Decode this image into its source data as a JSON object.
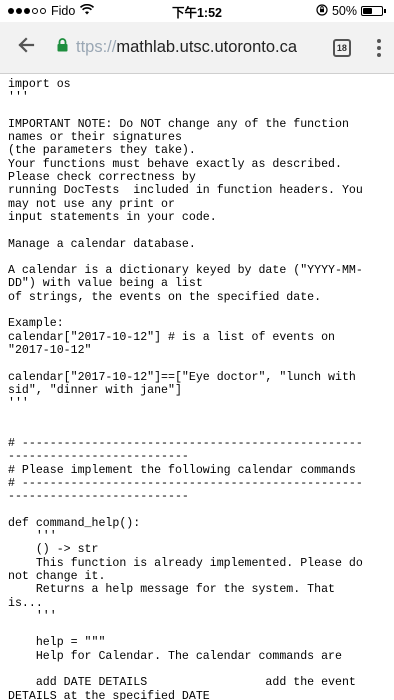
{
  "status_bar": {
    "carrier": "Fido",
    "time": "下午1:52",
    "battery_percent": "50%",
    "battery_level": 0.5,
    "signal_dots_filled": 3,
    "signal_dots_empty": 2
  },
  "toolbar": {
    "url_scheme": "ttps://",
    "url_host": "mathlab.utsc.utoronto.ca",
    "tab_count": "18"
  },
  "icons": {
    "back": "arrow-left-icon",
    "lock": "lock-icon",
    "wifi": "wifi-icon",
    "menu": "more-vert-icon"
  },
  "colors": {
    "lock": "#1e8e3e",
    "toolbar_bg": "#f2f2f2"
  },
  "code": {
    "lines": [
      "import os",
      "'''",
      "",
      "IMPORTANT NOTE: Do NOT change any of the function",
      "names or their signatures",
      "(the parameters they take).",
      "Your functions must behave exactly as described.",
      "Please check correctness by",
      "running DocTests  included in function headers. You",
      "may not use any print or",
      "input statements in your code.",
      "",
      "Manage a calendar database.",
      "",
      "A calendar is a dictionary keyed by date (\"YYYY-MM-",
      "DD\") with value being a list",
      "of strings, the events on the specified date.",
      "",
      "Example:",
      "calendar[\"2017-10-12\"] # is a list of events on",
      "\"2017-10-12\"",
      "",
      "calendar[\"2017-10-12\"]==[\"Eye doctor\", \"lunch with",
      "sid\", \"dinner with jane\"]",
      "'''",
      "",
      "",
      "# -------------------------------------------------",
      "--------------------------",
      "# Please implement the following calendar commands",
      "# -------------------------------------------------",
      "--------------------------",
      "",
      "def command_help():",
      "    '''",
      "    () -> str",
      "    This function is already implemented. Please do",
      "not change it.",
      "    Returns a help message for the system. That",
      "is...",
      "    '''",
      "",
      "    help = \"\"\"",
      "    Help for Calendar. The calendar commands are",
      "",
      "    add DATE DETAILS                 add the event",
      "DETAILS at the specified DATE"
    ]
  }
}
